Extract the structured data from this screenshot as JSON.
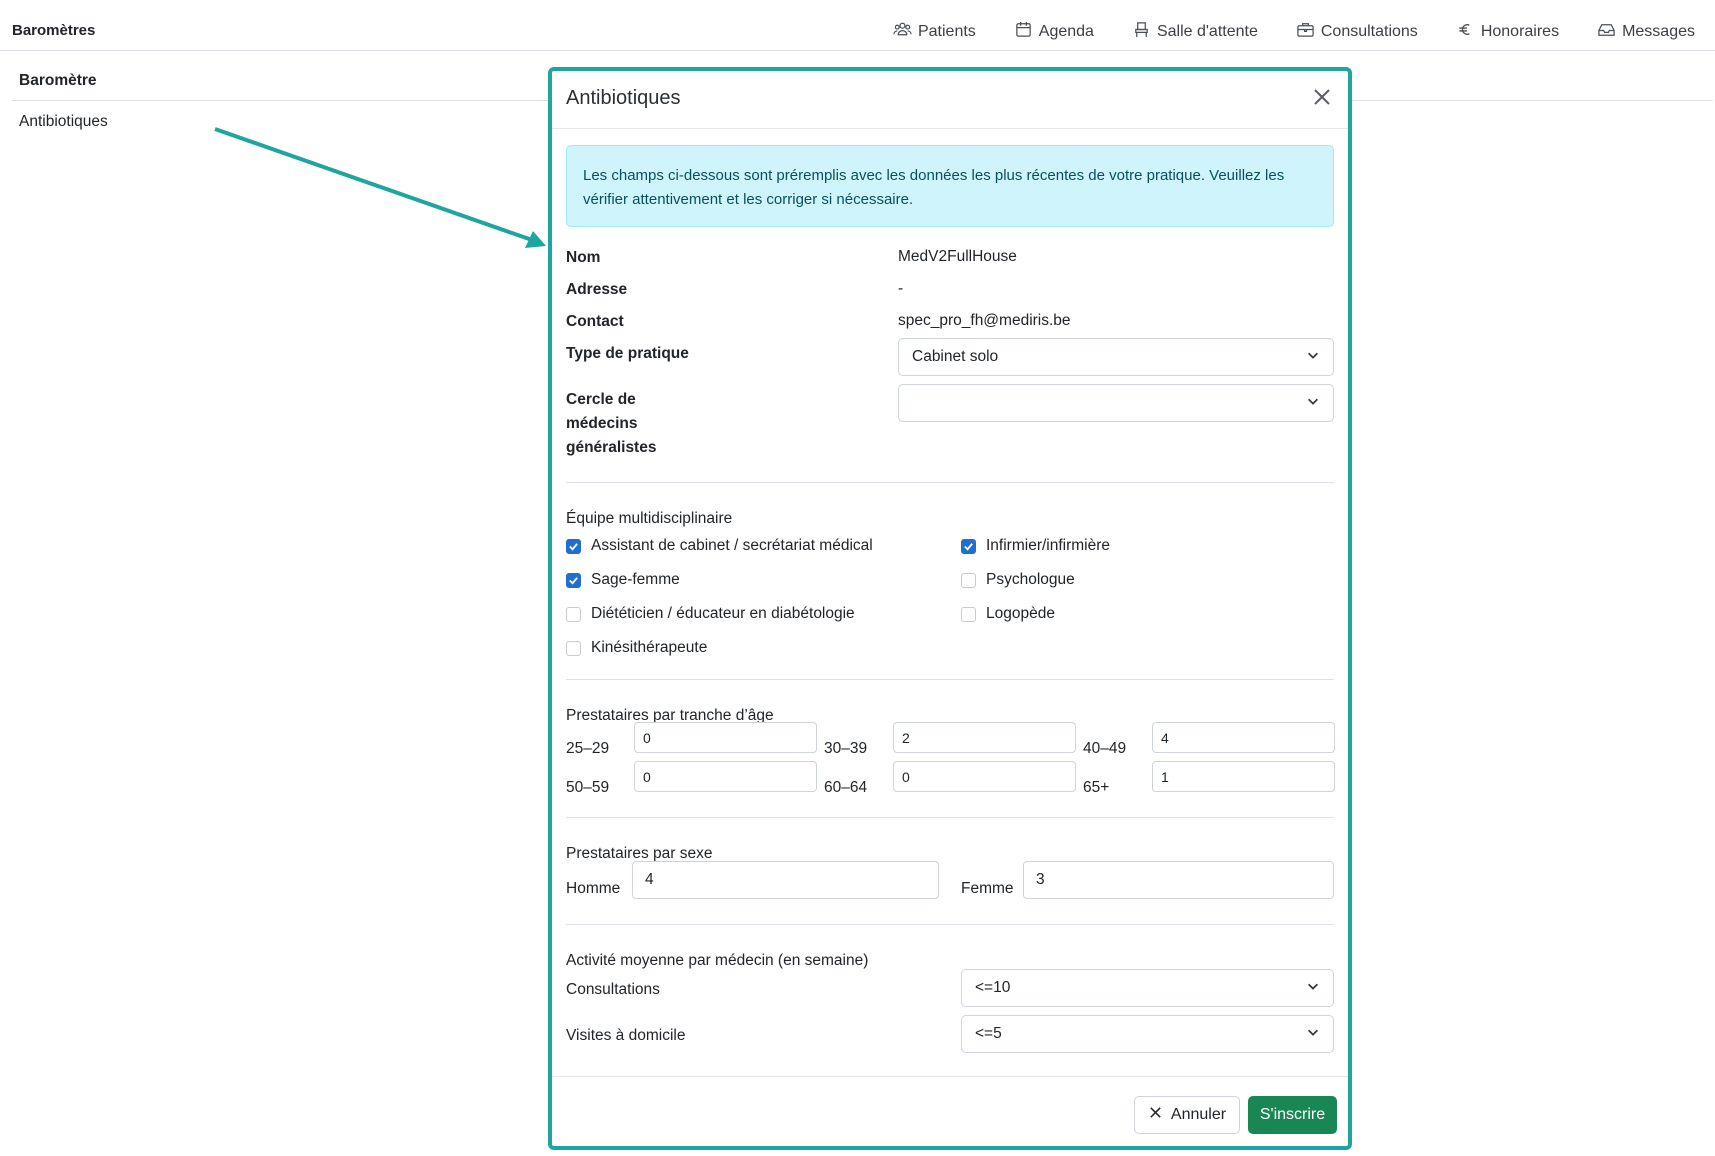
{
  "app": {
    "title": "Baromètres"
  },
  "nav": [
    {
      "label": "Patients",
      "icon": "users-icon"
    },
    {
      "label": "Agenda",
      "icon": "calendar-icon"
    },
    {
      "label": "Salle d'attente",
      "icon": "waiting-room-icon"
    },
    {
      "label": "Consultations",
      "icon": "briefcase-icon"
    },
    {
      "label": "Honoraires",
      "icon": "euro-icon"
    },
    {
      "label": "Messages",
      "icon": "inbox-icon"
    }
  ],
  "sidebar": {
    "heading": "Baromètre",
    "items": [
      {
        "label": "Antibiotiques"
      }
    ]
  },
  "modal": {
    "title": "Antibiotiques",
    "alert": "Les champs ci-dessous sont préremplis avec les données les plus récentes de votre pratique. Veuillez les vérifier attentivement et les corriger si nécessaire.",
    "fields": {
      "nom_label": "Nom",
      "nom_value": "MedV2FullHouse",
      "adresse_label": "Adresse",
      "adresse_value": "-",
      "contact_label": "Contact",
      "contact_value": "spec_pro_fh@mediris.be",
      "type_label": "Type de pratique",
      "type_value": "Cabinet solo",
      "cercle_label_1": "Cercle de",
      "cercle_label_2": "médecins",
      "cercle_label_3": "généralistes",
      "cercle_value": ""
    },
    "team": {
      "title": "Équipe multidisciplinaire",
      "items": [
        {
          "label": "Assistant de cabinet / secrétariat médical",
          "checked": true
        },
        {
          "label": "Infirmier/infirmière",
          "checked": true
        },
        {
          "label": "Sage-femme",
          "checked": true
        },
        {
          "label": "Psychologue",
          "checked": false
        },
        {
          "label": "Diététicien / éducateur en diabétologie",
          "checked": false
        },
        {
          "label": "Logopède",
          "checked": false
        },
        {
          "label": "Kinésithérapeute",
          "checked": false
        }
      ]
    },
    "age": {
      "title": "Prestataires par tranche d’âge",
      "groups": [
        {
          "label": "25–29",
          "value": "0"
        },
        {
          "label": "30–39",
          "value": "2"
        },
        {
          "label": "40–49",
          "value": "4"
        },
        {
          "label": "50–59",
          "value": "0"
        },
        {
          "label": "60–64",
          "value": "0"
        },
        {
          "label": "65+",
          "value": "1"
        }
      ]
    },
    "sex": {
      "title": "Prestataires par sexe",
      "homme_label": "Homme",
      "homme_value": "4",
      "femme_label": "Femme",
      "femme_value": "3"
    },
    "activity": {
      "title": "Activité moyenne par médecin (en semaine)",
      "consultations_label": "Consultations",
      "consultations_value": "<=10",
      "visites_label": "Visites à domicile",
      "visites_value": "<=5"
    },
    "buttons": {
      "cancel": "Annuler",
      "submit": "S'inscrire"
    }
  },
  "colors": {
    "accent": "#1fa5a1",
    "primary_check": "#1f6fd1",
    "success": "#198754",
    "alert_bg": "#cff4fc"
  }
}
